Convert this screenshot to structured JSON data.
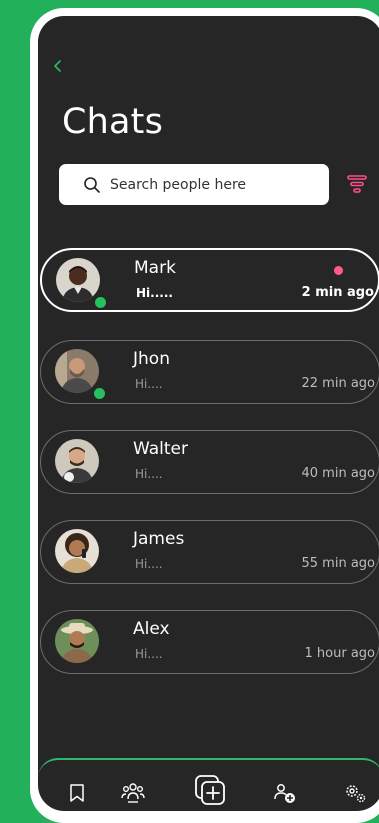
{
  "header": {
    "title": "Chats"
  },
  "search": {
    "placeholder": "Search people here"
  },
  "chats": [
    {
      "name": "Mark",
      "message": "Hi.....",
      "time": "2 min ago",
      "online": true,
      "unread": true,
      "active": true
    },
    {
      "name": "Jhon",
      "message": "Hi....",
      "time": "22 min ago",
      "online": true,
      "unread": false,
      "active": false
    },
    {
      "name": "Walter",
      "message": "Hi....",
      "time": "40 min ago",
      "online": false,
      "unread": false,
      "active": false
    },
    {
      "name": "James",
      "message": "Hi....",
      "time": "55 min ago",
      "online": false,
      "unread": false,
      "active": false
    },
    {
      "name": "Alex",
      "message": "Hi....",
      "time": "1 hour ago",
      "online": false,
      "unread": false,
      "active": false
    }
  ],
  "nav": {
    "items": [
      "bookmark-icon",
      "group-icon",
      "new-chat-icon",
      "add-contact-icon",
      "settings-icon"
    ]
  },
  "colors": {
    "accent": "#2fb866",
    "background": "#262626",
    "unread": "#ff5c8a",
    "page": "#22b05a"
  }
}
